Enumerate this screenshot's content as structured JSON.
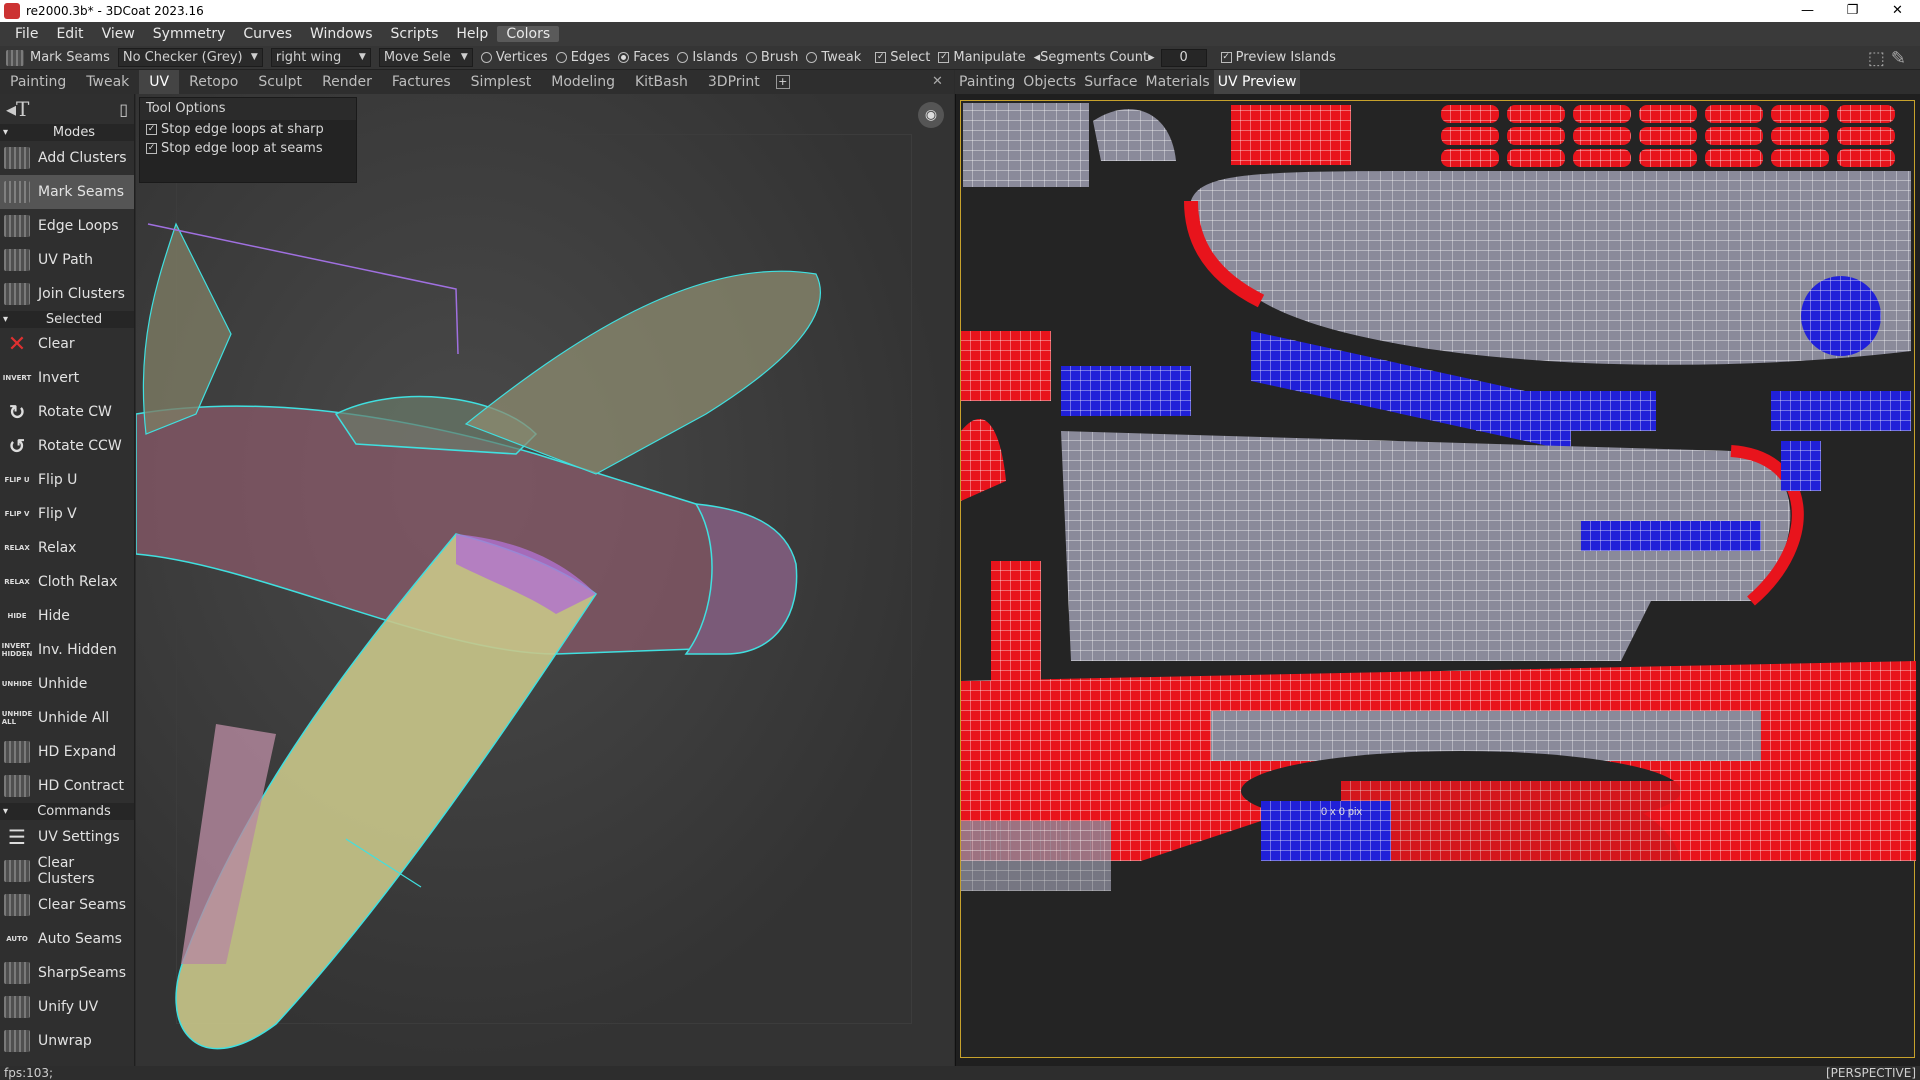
{
  "window": {
    "title": "re2000.3b* - 3DCoat 2023.16",
    "buttons": [
      "minimize",
      "maximize",
      "close"
    ]
  },
  "menu": [
    "File",
    "Edit",
    "View",
    "Symmetry",
    "Curves",
    "Windows",
    "Scripts",
    "Help",
    "Colors"
  ],
  "toolbar": {
    "tool_label": "Mark Seams",
    "checker": "No Checker (Grey)",
    "object": "right wing",
    "move": "Move Sele",
    "radios": [
      "Vertices",
      "Edges",
      "Faces",
      "Islands",
      "Brush",
      "Tweak"
    ],
    "radio_selected": "Faces",
    "checks": [
      "Select",
      "Manipulate"
    ],
    "segments_label": "Segments Count",
    "segments_value": "0",
    "preview_label": "Preview Islands"
  },
  "rooms": [
    "Painting",
    "Tweak",
    "UV",
    "Retopo",
    "Sculpt",
    "Render",
    "Factures",
    "Simplest",
    "Modeling",
    "KitBash",
    "3DPrint"
  ],
  "active_room": "UV",
  "right_tabs": [
    "Painting",
    "Objects",
    "Surface",
    "Materials",
    "UV Preview"
  ],
  "active_right_tab": "UV Preview",
  "sidebar": {
    "sections": {
      "modes": "Modes",
      "selected": "Selected",
      "commands": "Commands"
    },
    "modes": [
      {
        "label": "Add Clusters",
        "icon": "add-clusters-icon",
        "glyph": ""
      },
      {
        "label": "Mark Seams",
        "icon": "mark-seams-icon",
        "glyph": ""
      },
      {
        "label": "Edge Loops",
        "icon": "edge-loops-icon",
        "glyph": ""
      },
      {
        "label": "UV Path",
        "icon": "uv-path-icon",
        "glyph": ""
      },
      {
        "label": "Join Clusters",
        "icon": "join-clusters-icon",
        "glyph": ""
      }
    ],
    "selected": [
      {
        "label": "Clear",
        "glyph": "✕"
      },
      {
        "label": "Invert",
        "glyph": "INVERT"
      },
      {
        "label": "Rotate CW",
        "glyph": "↻"
      },
      {
        "label": "Rotate CCW",
        "glyph": "↺"
      },
      {
        "label": "Flip U",
        "glyph": "FLIP U"
      },
      {
        "label": "Flip V",
        "glyph": "FLIP V"
      },
      {
        "label": "Relax",
        "glyph": "RELAX"
      },
      {
        "label": "Cloth Relax",
        "glyph": "RELAX"
      },
      {
        "label": "Hide",
        "glyph": "HIDE"
      },
      {
        "label": "Inv. Hidden",
        "glyph": "INVERT HIDDEN"
      },
      {
        "label": "Unhide",
        "glyph": "UNHIDE"
      },
      {
        "label": "Unhide All",
        "glyph": "UNHIDE ALL"
      },
      {
        "label": "HD Expand",
        "glyph": "▦"
      },
      {
        "label": "HD Contract",
        "glyph": "▦"
      }
    ],
    "commands": [
      {
        "label": "UV Settings",
        "glyph": "☰"
      },
      {
        "label": "Clear Clusters",
        "glyph": "▦"
      },
      {
        "label": "Clear Seams",
        "glyph": "▦"
      },
      {
        "label": "Auto Seams",
        "glyph": "AUTO"
      },
      {
        "label": "SharpSeams",
        "glyph": "▦"
      },
      {
        "label": "Unify UV",
        "glyph": "▦"
      },
      {
        "label": "Unwrap",
        "glyph": "▦"
      }
    ]
  },
  "tool_options": {
    "title": "Tool Options",
    "options": [
      {
        "label": "Stop edge loops at sharp",
        "checked": true
      },
      {
        "label": "Stop edge loop at seams",
        "checked": true
      }
    ]
  },
  "uv_preview": {
    "readout": "0 x 0 pix"
  },
  "status": {
    "fps": "fps:103;",
    "view": "[PERSPECTIVE]"
  },
  "colors": {
    "uv_red": "#e8141c",
    "uv_blue": "#2020d8",
    "uv_grey": "#8a8a9a",
    "wing_yellow": "#c9c68a",
    "wing_pink": "#b78aa0",
    "seam_cyan": "#40e0e0"
  }
}
